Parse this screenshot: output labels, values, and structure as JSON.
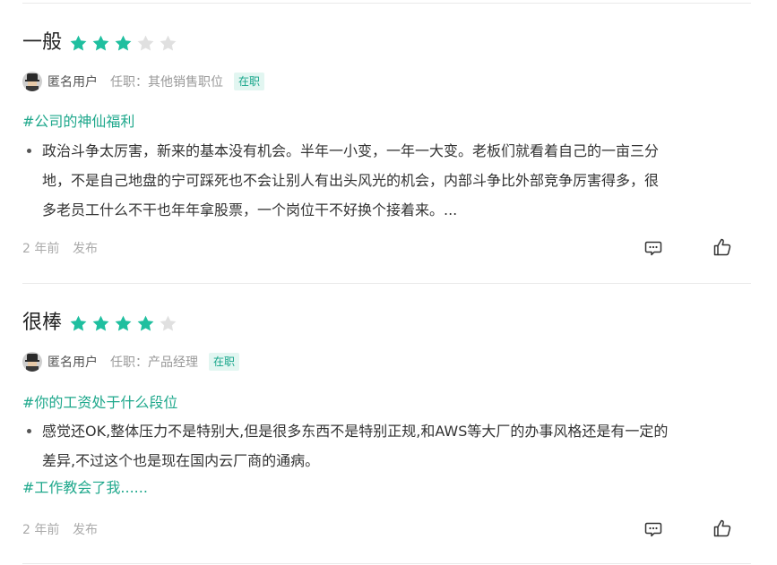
{
  "reviews": [
    {
      "rating_word": "一般",
      "stars": 3,
      "max_stars": 5,
      "author": "匿名用户",
      "position": "任职：其他销售职位",
      "status_badge": "在职",
      "topic": "#公司的神仙福利",
      "bullet_lines": [
        "政治斗争太厉害，新来的基本没有机会。半年一小变，一年一大变。老板们就看着自己的一亩三分",
        "地，不是自己地盘的宁可踩死也不会让别人有出头风光的机会，内部斗争比外部竞争厉害得多，很",
        "多老员工什么不干也年年拿股票，一个岗位干不好换个接着来。..."
      ],
      "time": "2 年前",
      "publish": "发布"
    },
    {
      "rating_word": "很棒",
      "stars": 4,
      "max_stars": 5,
      "author": "匿名用户",
      "position": "任职：产品经理",
      "status_badge": "在职",
      "topic": "#你的工资处于什么段位",
      "bullet_lines": [
        "感觉还OK,整体压力不是特别大,但是很多东西不是特别正规,和AWS等大厂的办事风格还是有一定的",
        "差异,不过这个也是现在国内云厂商的通病。"
      ],
      "topic2": "#工作教会了我......",
      "time": "2 年前",
      "publish": "发布"
    }
  ],
  "icons": {
    "star": "star-icon",
    "comment": "comment-icon",
    "like": "thumbs-up-icon"
  },
  "colors": {
    "accent": "#1fbf9f",
    "topic": "#1fa88c",
    "badge_bg": "#e2f6f1",
    "star_off": "#e0e0e0"
  }
}
